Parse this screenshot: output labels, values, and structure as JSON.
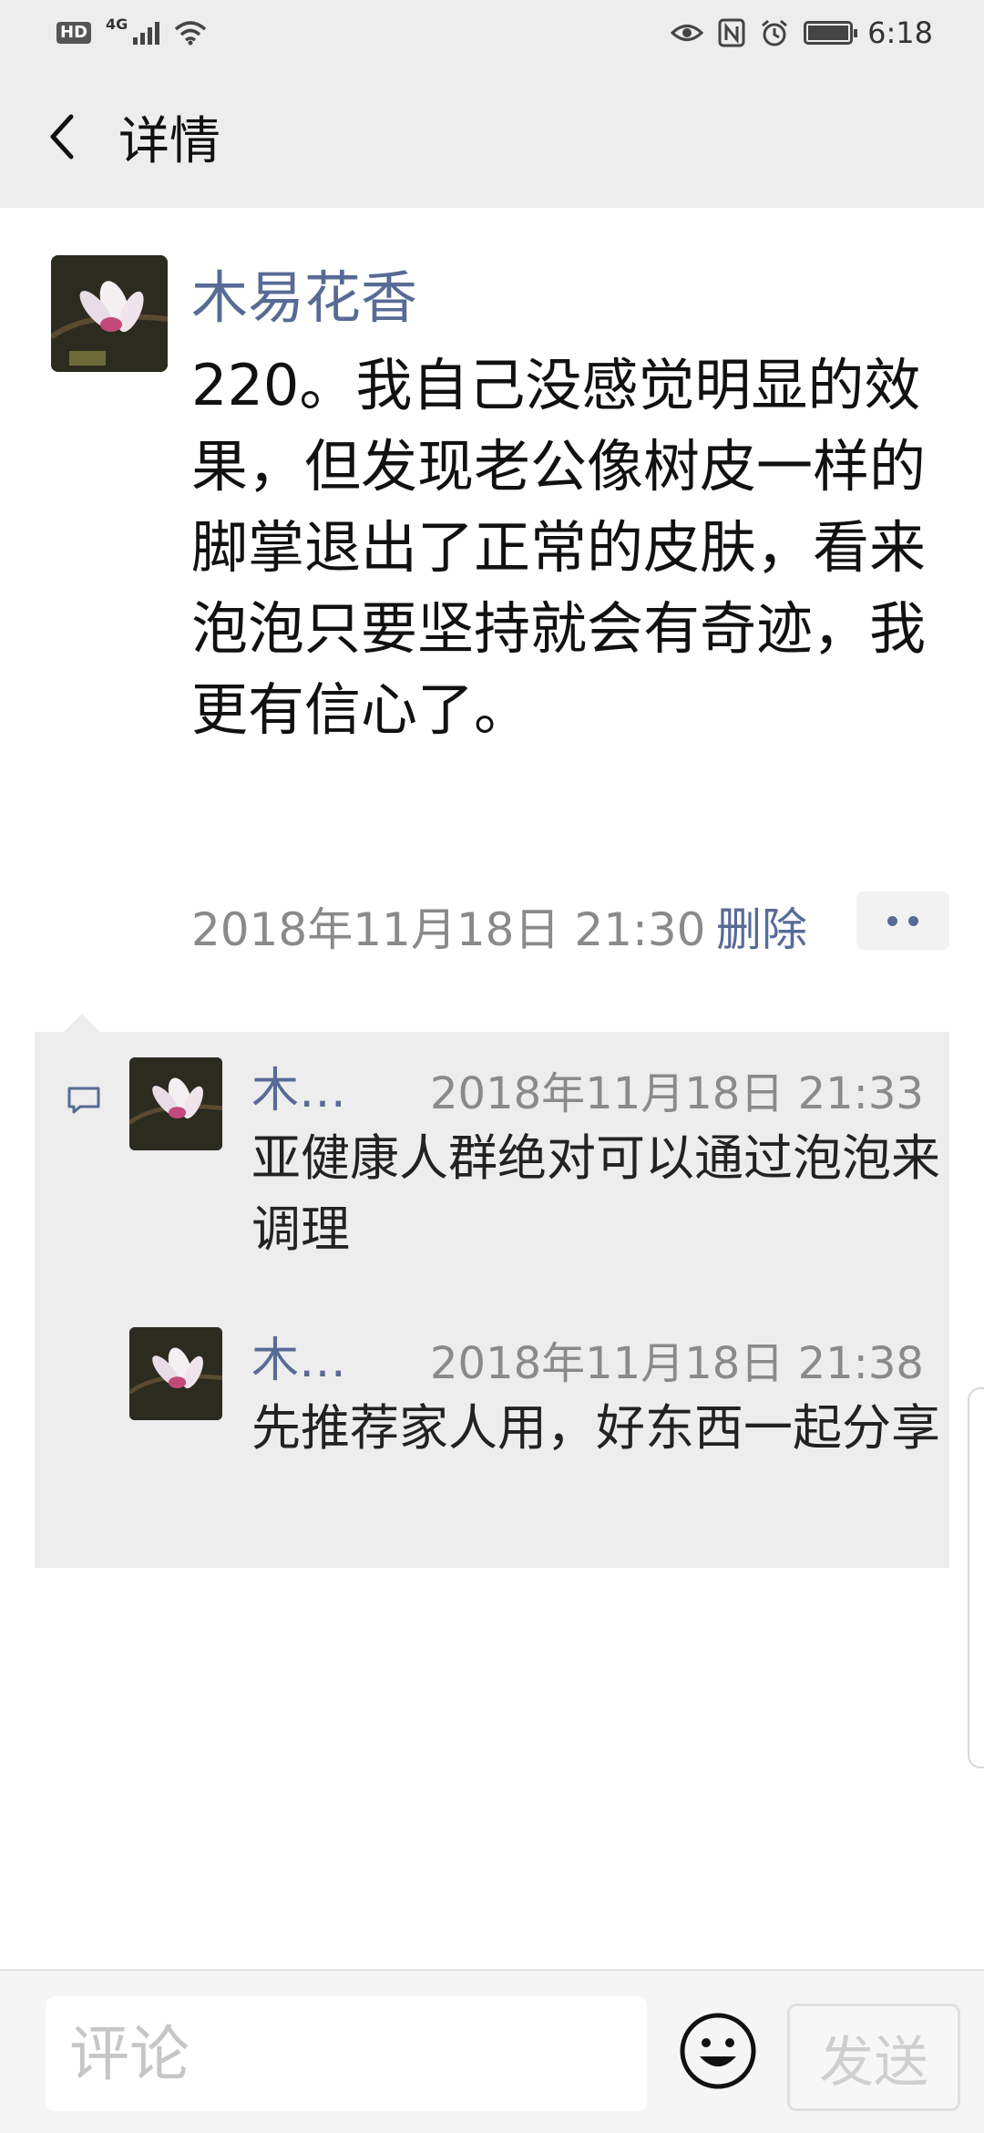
{
  "status_bar": {
    "network_type": "4G",
    "hd_label": "HD",
    "time": "6:18"
  },
  "header": {
    "title": "详情",
    "back_icon": "chevron-left-icon"
  },
  "post": {
    "author": "木易花香",
    "text": "220。我自己没感觉明显的效果，但发现老公像树皮一样的脚掌退出了正常的皮肤，看来泡泡只要坚持就会有奇迹，我更有信心了。",
    "timestamp": "2018年11月18日 21:30",
    "delete_label": "删除",
    "more_icon": "more-dots-icon"
  },
  "comments": [
    {
      "author": "木…",
      "time": "2018年11月18日 21:33",
      "text": "亚健康人群绝对可以通过泡泡来调理"
    },
    {
      "author": "木…",
      "time": "2018年11月18日 21:38",
      "text": "先推荐家人用，好东西一起分享"
    }
  ],
  "input_bar": {
    "placeholder": "评论",
    "send_label": "发送",
    "emoji_icon": "emoji-icon"
  },
  "colors": {
    "link": "#576b95",
    "header_bg": "#ededed",
    "timestamp": "#8a8a8a"
  }
}
